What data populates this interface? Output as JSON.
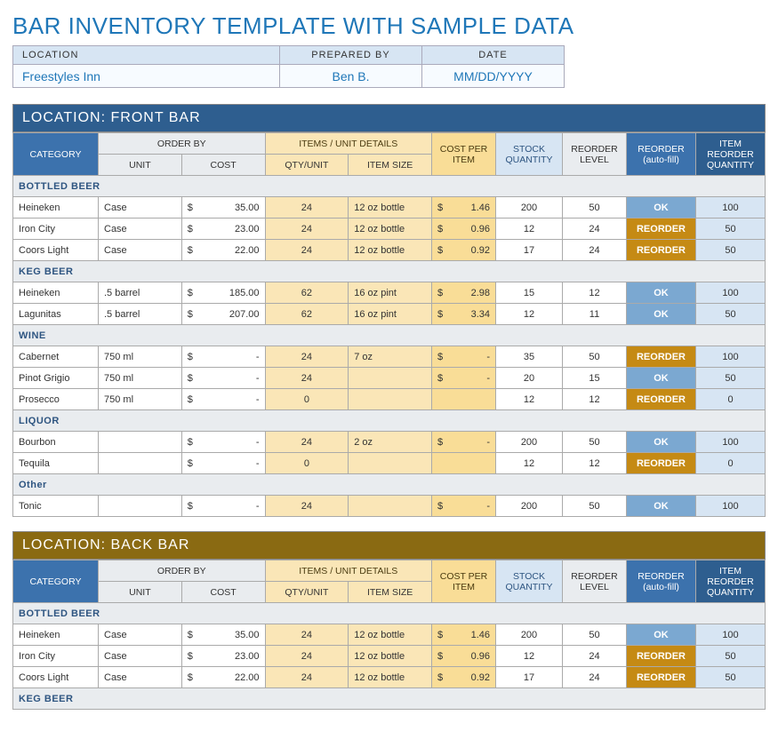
{
  "title": "BAR INVENTORY TEMPLATE WITH SAMPLE DATA",
  "meta": {
    "headers": {
      "location": "LOCATION",
      "prepared": "PREPARED BY",
      "date": "DATE"
    },
    "values": {
      "location": "Freestyles Inn",
      "prepared": "Ben B.",
      "date": "MM/DD/YYYY"
    }
  },
  "columns": {
    "category": "CATEGORY",
    "order_by": "ORDER BY",
    "unit": "UNIT",
    "cost": "COST",
    "items_unit": "ITEMS / UNIT DETAILS",
    "qty_unit": "QTY/UNIT",
    "item_size": "ITEM SIZE",
    "cost_per_item": "COST PER ITEM",
    "stock_qty": "STOCK QUANTITY",
    "reorder_level": "REORDER LEVEL",
    "reorder_auto": "REORDER (auto-fill)",
    "item_reorder_qty": "ITEM REORDER QUANTITY"
  },
  "status_labels": {
    "ok": "OK",
    "reorder": "REORDER"
  },
  "sections": [
    {
      "title": "LOCATION: FRONT BAR",
      "color": "blue",
      "groups": [
        {
          "name": "BOTTLED BEER",
          "rows": [
            {
              "name": "Heineken",
              "unit": "Case",
              "cost": "35.00",
              "qty": "24",
              "size": "12 oz bottle",
              "per": "1.46",
              "stock": "200",
              "level": "50",
              "status": "ok",
              "irq": "100"
            },
            {
              "name": "Iron City",
              "unit": "Case",
              "cost": "23.00",
              "qty": "24",
              "size": "12 oz bottle",
              "per": "0.96",
              "stock": "12",
              "level": "24",
              "status": "re",
              "irq": "50"
            },
            {
              "name": "Coors Light",
              "unit": "Case",
              "cost": "22.00",
              "qty": "24",
              "size": "12 oz bottle",
              "per": "0.92",
              "stock": "17",
              "level": "24",
              "status": "re",
              "irq": "50"
            }
          ]
        },
        {
          "name": "KEG BEER",
          "rows": [
            {
              "name": "Heineken",
              "unit": ".5 barrel",
              "cost": "185.00",
              "qty": "62",
              "size": "16 oz pint",
              "per": "2.98",
              "stock": "15",
              "level": "12",
              "status": "ok",
              "irq": "100"
            },
            {
              "name": "Lagunitas",
              "unit": ".5 barrel",
              "cost": "207.00",
              "qty": "62",
              "size": "16 oz pint",
              "per": "3.34",
              "stock": "12",
              "level": "11",
              "status": "ok",
              "irq": "50"
            }
          ]
        },
        {
          "name": "WINE",
          "rows": [
            {
              "name": "Cabernet",
              "unit": "750 ml",
              "cost": "-",
              "qty": "24",
              "size": "7 oz",
              "per": "-",
              "stock": "35",
              "level": "50",
              "status": "re",
              "irq": "100"
            },
            {
              "name": "Pinot Grigio",
              "unit": "750 ml",
              "cost": "-",
              "qty": "24",
              "size": "",
              "per": "-",
              "stock": "20",
              "level": "15",
              "status": "ok",
              "irq": "50"
            },
            {
              "name": "Prosecco",
              "unit": "750 ml",
              "cost": "-",
              "qty": "0",
              "size": "",
              "per": "",
              "stock": "12",
              "level": "12",
              "status": "re",
              "irq": "0"
            }
          ]
        },
        {
          "name": "LIQUOR",
          "rows": [
            {
              "name": "Bourbon",
              "unit": "",
              "cost": "-",
              "qty": "24",
              "size": "2 oz",
              "per": "-",
              "stock": "200",
              "level": "50",
              "status": "ok",
              "irq": "100"
            },
            {
              "name": "Tequila",
              "unit": "",
              "cost": "-",
              "qty": "0",
              "size": "",
              "per": "",
              "stock": "12",
              "level": "12",
              "status": "re",
              "irq": "0"
            }
          ]
        },
        {
          "name": "Other",
          "rows": [
            {
              "name": "Tonic",
              "unit": "",
              "cost": "-",
              "qty": "24",
              "size": "",
              "per": "-",
              "stock": "200",
              "level": "50",
              "status": "ok",
              "irq": "100"
            }
          ]
        }
      ]
    },
    {
      "title": "LOCATION: BACK BAR",
      "color": "gold",
      "groups": [
        {
          "name": "BOTTLED BEER",
          "rows": [
            {
              "name": "Heineken",
              "unit": "Case",
              "cost": "35.00",
              "qty": "24",
              "size": "12 oz bottle",
              "per": "1.46",
              "stock": "200",
              "level": "50",
              "status": "ok",
              "irq": "100"
            },
            {
              "name": "Iron City",
              "unit": "Case",
              "cost": "23.00",
              "qty": "24",
              "size": "12 oz bottle",
              "per": "0.96",
              "stock": "12",
              "level": "24",
              "status": "re",
              "irq": "50"
            },
            {
              "name": "Coors Light",
              "unit": "Case",
              "cost": "22.00",
              "qty": "24",
              "size": "12 oz bottle",
              "per": "0.92",
              "stock": "17",
              "level": "24",
              "status": "re",
              "irq": "50"
            }
          ]
        },
        {
          "name": "KEG BEER",
          "rows": []
        }
      ]
    }
  ]
}
